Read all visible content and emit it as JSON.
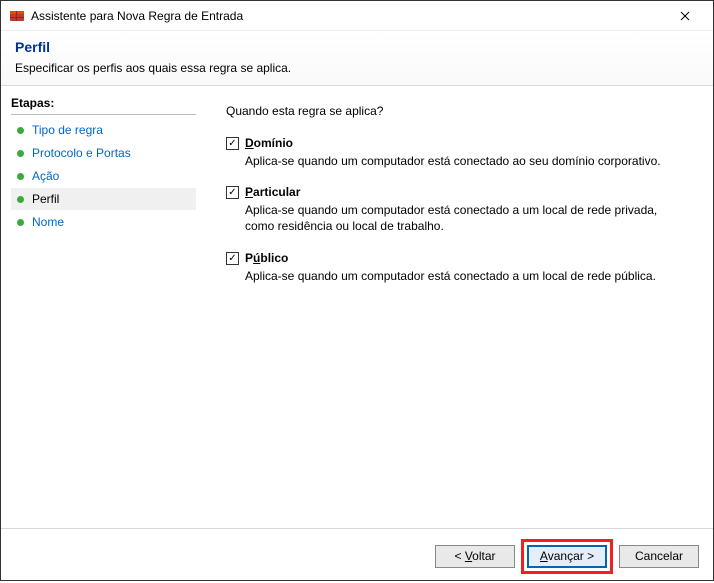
{
  "window": {
    "title": "Assistente para Nova Regra de Entrada"
  },
  "header": {
    "title": "Perfil",
    "subtitle": "Especificar os perfis aos quais essa regra se aplica."
  },
  "sidebar": {
    "heading": "Etapas:",
    "steps": [
      {
        "label": "Tipo de regra",
        "active": false
      },
      {
        "label": "Protocolo e Portas",
        "active": false
      },
      {
        "label": "Ação",
        "active": false
      },
      {
        "label": "Perfil",
        "active": true
      },
      {
        "label": "Nome",
        "active": false
      }
    ]
  },
  "content": {
    "question": "Quando esta regra se aplica?",
    "profiles": [
      {
        "checked": true,
        "label_pre": "",
        "label_u": "D",
        "label_post": "omínio",
        "desc": "Aplica-se quando um computador está conectado ao seu domínio corporativo."
      },
      {
        "checked": true,
        "label_pre": "",
        "label_u": "P",
        "label_post": "articular",
        "desc": "Aplica-se quando um computador está conectado a um local de rede privada, como residência ou local de trabalho."
      },
      {
        "checked": true,
        "label_pre": "P",
        "label_u": "ú",
        "label_post": "blico",
        "desc": "Aplica-se quando um computador está conectado a um local de rede pública."
      }
    ]
  },
  "buttons": {
    "back_pre": "< ",
    "back_u": "V",
    "back_post": "oltar",
    "next_pre": "",
    "next_u": "A",
    "next_post": "vançar >",
    "cancel": "Cancelar"
  }
}
